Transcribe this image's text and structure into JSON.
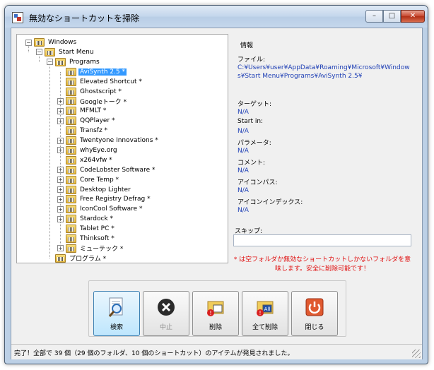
{
  "window": {
    "title": "無効なショートカットを掃除",
    "controls": {
      "minimize": "–",
      "maximize": "□",
      "close": "✕"
    }
  },
  "tree": {
    "items": [
      {
        "label": "Windows",
        "depth": 0,
        "expander": "−",
        "selected": false,
        "dash": false
      },
      {
        "label": "Start Menu",
        "depth": 1,
        "expander": "−",
        "selected": false,
        "dash": false
      },
      {
        "label": "Programs",
        "depth": 2,
        "expander": "−",
        "selected": false,
        "dash": false
      },
      {
        "label": "AviSynth 2.5 *",
        "depth": 3,
        "expander": "",
        "selected": true,
        "dash": false
      },
      {
        "label": "Elevated Shortcut *",
        "depth": 3,
        "expander": "",
        "selected": false,
        "dash": false
      },
      {
        "label": "Ghostscript *",
        "depth": 3,
        "expander": "",
        "selected": false,
        "dash": false
      },
      {
        "label": "Googleトーク *",
        "depth": 3,
        "expander": "+",
        "selected": false,
        "dash": false
      },
      {
        "label": "MFMLT *",
        "depth": 3,
        "expander": "+",
        "selected": false,
        "dash": false
      },
      {
        "label": "QQPlayer *",
        "depth": 3,
        "expander": "+",
        "selected": false,
        "dash": false
      },
      {
        "label": "Transfz *",
        "depth": 3,
        "expander": "",
        "selected": false,
        "dash": false
      },
      {
        "label": "Twentyone Innovations *",
        "depth": 3,
        "expander": "+",
        "selected": false,
        "dash": false
      },
      {
        "label": "whyEye.org",
        "depth": 3,
        "expander": "+",
        "selected": false,
        "dash": false
      },
      {
        "label": "x264vfw *",
        "depth": 3,
        "expander": "",
        "selected": false,
        "dash": false
      },
      {
        "label": "CodeLobster Software *",
        "depth": 3,
        "expander": "+",
        "selected": false,
        "dash": false
      },
      {
        "label": "Core Temp *",
        "depth": 3,
        "expander": "+",
        "selected": false,
        "dash": false
      },
      {
        "label": "Desktop Lighter",
        "depth": 3,
        "expander": "+",
        "selected": false,
        "dash": false
      },
      {
        "label": "Free Registry Defrag *",
        "depth": 3,
        "expander": "+",
        "selected": false,
        "dash": false
      },
      {
        "label": "IconCool Software *",
        "depth": 3,
        "expander": "+",
        "selected": false,
        "dash": false
      },
      {
        "label": "Stardock *",
        "depth": 3,
        "expander": "+",
        "selected": false,
        "dash": false
      },
      {
        "label": "Tablet PC *",
        "depth": 3,
        "expander": "",
        "selected": false,
        "dash": false
      },
      {
        "label": "Thinksoft *",
        "depth": 3,
        "expander": "",
        "selected": false,
        "dash": false
      },
      {
        "label": "ミューテック *",
        "depth": 3,
        "expander": "+",
        "selected": false,
        "dash": false
      },
      {
        "label": "プログラム *",
        "depth": 2,
        "expander": "",
        "selected": false,
        "dash": false
      }
    ]
  },
  "info": {
    "group_label": "情報",
    "file_label": "ファイル:",
    "file_value": "C:¥Users¥user¥AppData¥Roaming¥Microsoft¥Windows¥Start Menu¥Programs¥AviSynth 2.5¥",
    "target_label": "ターゲット:",
    "target_value": "N/A",
    "startin_label": "Start in:",
    "startin_value": "N/A",
    "params_label": "パラメータ:",
    "params_value": "N/A",
    "comment_label": "コメント:",
    "comment_value": "N/A",
    "iconpath_label": "アイコンパス:",
    "iconpath_value": "N/A",
    "iconindex_label": "アイコンインデックス:",
    "iconindex_value": "N/A"
  },
  "skip": {
    "label": "スキップ:",
    "value": ""
  },
  "note": "* は空フォルダか無効なショートカットしかないフォルダを意味します。安全に削除可能です！",
  "buttons": {
    "search": "検索",
    "stop": "中止",
    "delete": "削除",
    "delete_all": "全て削除",
    "close": "閉じる"
  },
  "status": "完了！全部で 39 個（29 個のフォルダ、10 個のショートカット）のアイテムが発見されました。",
  "colors": {
    "selection": "#3399ff",
    "value_text": "#1e3fb5",
    "note_text": "#e01010"
  }
}
